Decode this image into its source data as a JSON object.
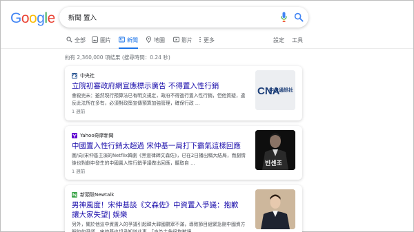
{
  "logo": {
    "text": "Google"
  },
  "search": {
    "query": "新聞 置入"
  },
  "tabs": [
    {
      "label": "全部",
      "icon": "search-icon"
    },
    {
      "label": "圖片",
      "icon": "image-icon"
    },
    {
      "label": "新聞",
      "icon": "news-icon",
      "active": true
    },
    {
      "label": "地圖",
      "icon": "map-pin-icon"
    },
    {
      "label": "影片",
      "icon": "video-icon"
    },
    {
      "label": "更多",
      "icon": "more-dots-icon"
    }
  ],
  "settings_label": "設定",
  "tools_label": "工具",
  "stats": "約有 2,360,000 項結果 (搜尋時間：0.24 秒)",
  "colors": {
    "link": "#1a0dab",
    "accent": "#1a73e8",
    "text": "#4d5156",
    "meta": "#70757a"
  },
  "results": [
    {
      "source": "中央社",
      "title": "立院初審政府網宣應標示廣告 不得置入性行銷",
      "snippet": "會殺完未：雖然現行預算法已有明文規定，政府不得進行置入性行銷，但他質疑，違反此法所在多有，必須對政策宣傳預算加強管理，確保行政 ...",
      "age": "1 週前",
      "thumb_text": "中央通訊社"
    },
    {
      "source": "Yahoo奇摩新聞",
      "title": "中國置入性行銷太超過 宋仲基一局打下霸氣這樣回應",
      "snippet": "圖/向/宋仲基主演的Netflix韓劇《黑道律師文森佐》，已在2日播出稱大結局，而劇情後也對劇中發生的中國置入性行銷爭議做出回應，聽取自 ...",
      "age": "1 週前",
      "thumb_text": "빈센조"
    },
    {
      "source": "新頭殼Newtalk",
      "title": "男神風度！宋仲基談《文森佐》中資置入爭議：抱歉讓大家失望| 娛樂",
      "snippet": "另外，關於他這中資置入的爭議引起韓大韓國觀眾不滿，導致節目組緊急刪中國資方解約的爭議，宋仲基也坦承知道此事，「身為主角很抱歉讓 ...",
      "age": "",
      "thumb_text": ""
    }
  ]
}
